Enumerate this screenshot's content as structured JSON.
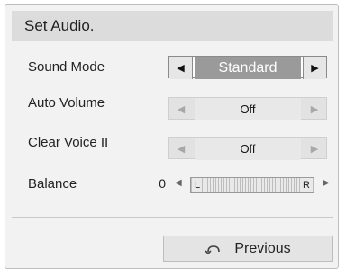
{
  "title": "Set Audio.",
  "rows": [
    {
      "label": "Sound Mode",
      "value": "Standard"
    },
    {
      "label": "Auto Volume",
      "value": "Off"
    },
    {
      "label": "Clear Voice II",
      "value": "Off"
    }
  ],
  "balance": {
    "label": "Balance",
    "value": "0",
    "left_label": "L",
    "right_label": "R"
  },
  "arrows": {
    "left": "◀",
    "right": "▶"
  },
  "previous_button": {
    "label": "Previous",
    "icon": "return-icon"
  },
  "colors": {
    "title_bg": "#dcdcdc",
    "active_value_bg": "#9a9a9a",
    "panel_bg": "#f2f2f2"
  }
}
